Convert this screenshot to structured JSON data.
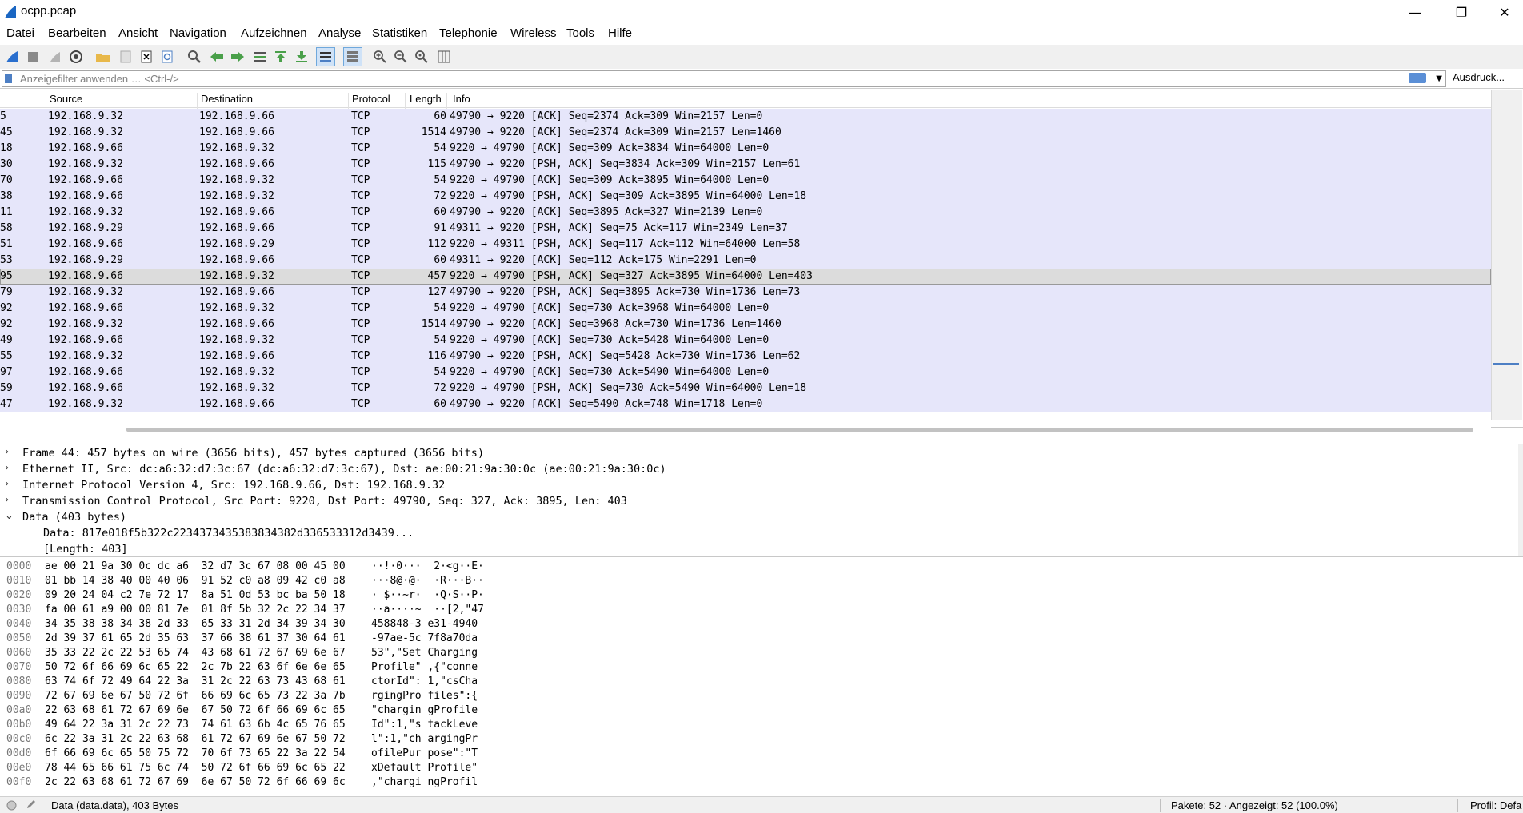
{
  "window": {
    "title": "ocpp.pcap",
    "controls": [
      "—",
      "❐",
      "✕"
    ]
  },
  "menu": [
    "Datei",
    "Bearbeiten",
    "Ansicht",
    "Navigation",
    "Aufzeichnen",
    "Analyse",
    "Statistiken",
    "Telephonie",
    "Wireless",
    "Tools",
    "Hilfe"
  ],
  "filter": {
    "placeholder": "Anzeigefilter anwenden … <Ctrl-/>",
    "expression_button": "Ausdruck..."
  },
  "columns": {
    "source": "Source",
    "destination": "Destination",
    "protocol": "Protocol",
    "length": "Length",
    "info": "Info"
  },
  "packets": [
    {
      "no": "5",
      "src": "192.168.9.32",
      "dst": "192.168.9.66",
      "proto": "TCP",
      "len": "60",
      "info": "49790 → 9220 [ACK] Seq=2374 Ack=309 Win=2157 Len=0"
    },
    {
      "no": "45",
      "src": "192.168.9.32",
      "dst": "192.168.9.66",
      "proto": "TCP",
      "len": "1514",
      "info": "49790 → 9220 [ACK] Seq=2374 Ack=309 Win=2157 Len=1460"
    },
    {
      "no": "18",
      "src": "192.168.9.66",
      "dst": "192.168.9.32",
      "proto": "TCP",
      "len": "54",
      "info": "9220 → 49790 [ACK] Seq=309 Ack=3834 Win=64000 Len=0"
    },
    {
      "no": "30",
      "src": "192.168.9.32",
      "dst": "192.168.9.66",
      "proto": "TCP",
      "len": "115",
      "info": "49790 → 9220 [PSH, ACK] Seq=3834 Ack=309 Win=2157 Len=61"
    },
    {
      "no": "70",
      "src": "192.168.9.66",
      "dst": "192.168.9.32",
      "proto": "TCP",
      "len": "54",
      "info": "9220 → 49790 [ACK] Seq=309 Ack=3895 Win=64000 Len=0"
    },
    {
      "no": "38",
      "src": "192.168.9.66",
      "dst": "192.168.9.32",
      "proto": "TCP",
      "len": "72",
      "info": "9220 → 49790 [PSH, ACK] Seq=309 Ack=3895 Win=64000 Len=18"
    },
    {
      "no": "11",
      "src": "192.168.9.32",
      "dst": "192.168.9.66",
      "proto": "TCP",
      "len": "60",
      "info": "49790 → 9220 [ACK] Seq=3895 Ack=327 Win=2139 Len=0"
    },
    {
      "no": "58",
      "src": "192.168.9.29",
      "dst": "192.168.9.66",
      "proto": "TCP",
      "len": "91",
      "info": "49311 → 9220 [PSH, ACK] Seq=75 Ack=117 Win=2349 Len=37"
    },
    {
      "no": "51",
      "src": "192.168.9.66",
      "dst": "192.168.9.29",
      "proto": "TCP",
      "len": "112",
      "info": "9220 → 49311 [PSH, ACK] Seq=117 Ack=112 Win=64000 Len=58"
    },
    {
      "no": "53",
      "src": "192.168.9.29",
      "dst": "192.168.9.66",
      "proto": "TCP",
      "len": "60",
      "info": "49311 → 9220 [ACK] Seq=112 Ack=175 Win=2291 Len=0"
    },
    {
      "no": "95",
      "src": "192.168.9.66",
      "dst": "192.168.9.32",
      "proto": "TCP",
      "len": "457",
      "info": "9220 → 49790 [PSH, ACK] Seq=327 Ack=3895 Win=64000 Len=403",
      "selected": true
    },
    {
      "no": "79",
      "src": "192.168.9.32",
      "dst": "192.168.9.66",
      "proto": "TCP",
      "len": "127",
      "info": "49790 → 9220 [PSH, ACK] Seq=3895 Ack=730 Win=1736 Len=73"
    },
    {
      "no": "92",
      "src": "192.168.9.66",
      "dst": "192.168.9.32",
      "proto": "TCP",
      "len": "54",
      "info": "9220 → 49790 [ACK] Seq=730 Ack=3968 Win=64000 Len=0"
    },
    {
      "no": "92",
      "src": "192.168.9.32",
      "dst": "192.168.9.66",
      "proto": "TCP",
      "len": "1514",
      "info": "49790 → 9220 [ACK] Seq=3968 Ack=730 Win=1736 Len=1460"
    },
    {
      "no": "49",
      "src": "192.168.9.66",
      "dst": "192.168.9.32",
      "proto": "TCP",
      "len": "54",
      "info": "9220 → 49790 [ACK] Seq=730 Ack=5428 Win=64000 Len=0"
    },
    {
      "no": "55",
      "src": "192.168.9.32",
      "dst": "192.168.9.66",
      "proto": "TCP",
      "len": "116",
      "info": "49790 → 9220 [PSH, ACK] Seq=5428 Ack=730 Win=1736 Len=62"
    },
    {
      "no": "97",
      "src": "192.168.9.66",
      "dst": "192.168.9.32",
      "proto": "TCP",
      "len": "54",
      "info": "9220 → 49790 [ACK] Seq=730 Ack=5490 Win=64000 Len=0"
    },
    {
      "no": "59",
      "src": "192.168.9.66",
      "dst": "192.168.9.32",
      "proto": "TCP",
      "len": "72",
      "info": "9220 → 49790 [PSH, ACK] Seq=730 Ack=5490 Win=64000 Len=18"
    },
    {
      "no": "47",
      "src": "192.168.9.32",
      "dst": "192.168.9.66",
      "proto": "TCP",
      "len": "60",
      "info": "49790 → 9220 [ACK] Seq=5490 Ack=748 Win=1718 Len=0"
    }
  ],
  "details": [
    {
      "chevron": "›",
      "indent": 0,
      "text": "Frame 44: 457 bytes on wire (3656 bits), 457 bytes captured (3656 bits)"
    },
    {
      "chevron": "›",
      "indent": 0,
      "text": "Ethernet II, Src: dc:a6:32:d7:3c:67 (dc:a6:32:d7:3c:67), Dst: ae:00:21:9a:30:0c (ae:00:21:9a:30:0c)"
    },
    {
      "chevron": "›",
      "indent": 0,
      "text": "Internet Protocol Version 4, Src: 192.168.9.66, Dst: 192.168.9.32"
    },
    {
      "chevron": "›",
      "indent": 0,
      "text": "Transmission Control Protocol, Src Port: 9220, Dst Port: 49790, Seq: 327, Ack: 3895, Len: 403"
    },
    {
      "chevron": "⌄",
      "indent": 0,
      "text": "Data (403 bytes)"
    },
    {
      "chevron": "",
      "indent": 1,
      "text": "Data: 817e018f5b322c2234373435383834382d336533312d3439..."
    },
    {
      "chevron": "",
      "indent": 1,
      "text": "[Length: 403]"
    }
  ],
  "bytes": [
    {
      "off": "0000",
      "hex": "ae 00 21 9a 30 0c dc a6  32 d7 3c 67 08 00 45 00",
      "ascii": "··!·0···  2·<g··E·"
    },
    {
      "off": "0010",
      "hex": "01 bb 14 38 40 00 40 06  91 52 c0 a8 09 42 c0 a8",
      "ascii": "···8@·@·  ·R···B··"
    },
    {
      "off": "0020",
      "hex": "09 20 24 04 c2 7e 72 17  8a 51 0d 53 bc ba 50 18",
      "ascii": "· $··~r·  ·Q·S··P·"
    },
    {
      "off": "0030",
      "hex": "fa 00 61 a9 00 00 81 7e  01 8f 5b 32 2c 22 34 37",
      "ascii": "··a····~  ··[2,\"47"
    },
    {
      "off": "0040",
      "hex": "34 35 38 38 34 38 2d 33  65 33 31 2d 34 39 34 30",
      "ascii": "458848-3 e31-4940"
    },
    {
      "off": "0050",
      "hex": "2d 39 37 61 65 2d 35 63  37 66 38 61 37 30 64 61",
      "ascii": "-97ae-5c 7f8a70da"
    },
    {
      "off": "0060",
      "hex": "35 33 22 2c 22 53 65 74  43 68 61 72 67 69 6e 67",
      "ascii": "53\",\"Set Charging"
    },
    {
      "off": "0070",
      "hex": "50 72 6f 66 69 6c 65 22  2c 7b 22 63 6f 6e 6e 65",
      "ascii": "Profile\" ,{\"conne"
    },
    {
      "off": "0080",
      "hex": "63 74 6f 72 49 64 22 3a  31 2c 22 63 73 43 68 61",
      "ascii": "ctorId\": 1,\"csCha"
    },
    {
      "off": "0090",
      "hex": "72 67 69 6e 67 50 72 6f  66 69 6c 65 73 22 3a 7b",
      "ascii": "rgingPro files\":{"
    },
    {
      "off": "00a0",
      "hex": "22 63 68 61 72 67 69 6e  67 50 72 6f 66 69 6c 65",
      "ascii": "\"chargin gProfile"
    },
    {
      "off": "00b0",
      "hex": "49 64 22 3a 31 2c 22 73  74 61 63 6b 4c 65 76 65",
      "ascii": "Id\":1,\"s tackLeve"
    },
    {
      "off": "00c0",
      "hex": "6c 22 3a 31 2c 22 63 68  61 72 67 69 6e 67 50 72",
      "ascii": "l\":1,\"ch argingPr"
    },
    {
      "off": "00d0",
      "hex": "6f 66 69 6c 65 50 75 72  70 6f 73 65 22 3a 22 54",
      "ascii": "ofilePur pose\":\"T"
    },
    {
      "off": "00e0",
      "hex": "78 44 65 66 61 75 6c 74  50 72 6f 66 69 6c 65 22",
      "ascii": "xDefault Profile\""
    },
    {
      "off": "00f0",
      "hex": "2c 22 63 68 61 72 67 69  6e 67 50 72 6f 66 69 6c",
      "ascii": ",\"chargi ngProfil"
    }
  ],
  "status": {
    "field": "Data (data.data), 403 Bytes",
    "packets": "Pakete: 52 · Angezeigt: 52 (100.0%)",
    "profile": "Profil: Defa"
  },
  "colors": {
    "row_bg": "#e6e6fa",
    "selected_bg": "#dcdcdc",
    "accent": "#4d7fc4"
  }
}
